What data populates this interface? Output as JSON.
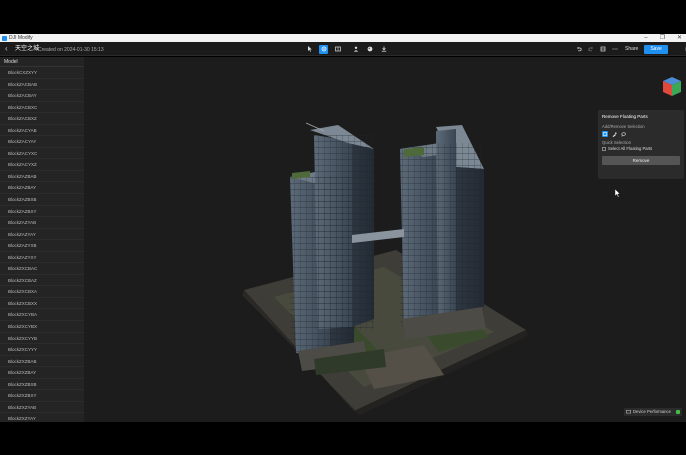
{
  "window": {
    "app_title": "DJI Modify",
    "controls": [
      "–",
      "❐",
      "✕"
    ]
  },
  "header": {
    "project_title": "天空之城",
    "created": "Created on 2024-01-30 15:13",
    "share_label": "Share",
    "save_label": "Save"
  },
  "sidebar": {
    "title": "Model",
    "items": [
      "BlockCXZXYY",
      "BlockZACBAB",
      "BlockZACBAY",
      "BlockZACBXC",
      "BlockZACBXZ",
      "BlockZACYAB",
      "BlockZACYAY",
      "BlockZACYXC",
      "BlockZACYXZ",
      "BlockZAZBAB",
      "BlockZAZBAY",
      "BlockZAZBXB",
      "BlockZAZBXY",
      "BlockZAZYAB",
      "BlockZAZYAY",
      "BlockZAZYXB",
      "BlockZAZYXY",
      "BlockZXCBAC",
      "BlockZXCBAZ",
      "BlockZXCBXA",
      "BlockZXCBXX",
      "BlockZXCYBA",
      "BlockZXCYBX",
      "BlockZXCYYB",
      "BlockZXCYYY",
      "BlockZXZBAB",
      "BlockZXZBAY",
      "BlockZXZBXB",
      "BlockZXZBXY",
      "BlockZXZYAB",
      "BlockZXZYAY"
    ]
  },
  "panel": {
    "title": "Remove Floating Parts",
    "add_remove_label": "Add/Remove Selection",
    "quick_label": "Quick Selection",
    "select_all_label": "Select All Floating Parts",
    "remove_label": "Remove"
  },
  "perf": {
    "label": "Device Performance"
  },
  "colors": {
    "accent": "#1f8ff0",
    "panel_bg": "#2b2b2b",
    "sidebar_bg": "#242424",
    "viewport_bg": "#1c1c1c",
    "perf_ok": "#3fbf4a"
  },
  "icons": {
    "back": "‹",
    "user": "👤"
  }
}
